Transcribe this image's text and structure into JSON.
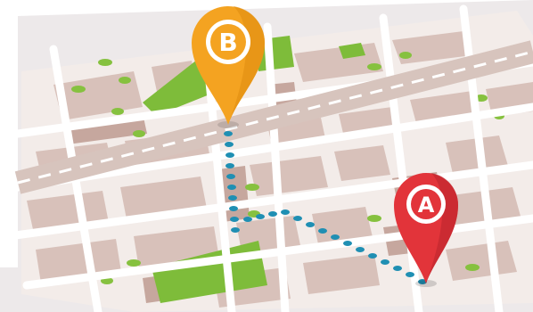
{
  "map": {
    "pins": [
      {
        "id": "origin",
        "label": "A",
        "color": "#e2343a",
        "inner_color": "#ffffff"
      },
      {
        "id": "destination",
        "label": "B",
        "color": "#f4a321",
        "inner_color": "#ffffff"
      }
    ],
    "colors": {
      "background": "#ffffff",
      "land": "#f2ecea",
      "block": "#d9c3bd",
      "block_dark": "#c8aca4",
      "road": "#ffffff",
      "highway": "#dcc9c2",
      "park": "#7ebc3a",
      "route_dot": "#1f8fb3"
    }
  }
}
